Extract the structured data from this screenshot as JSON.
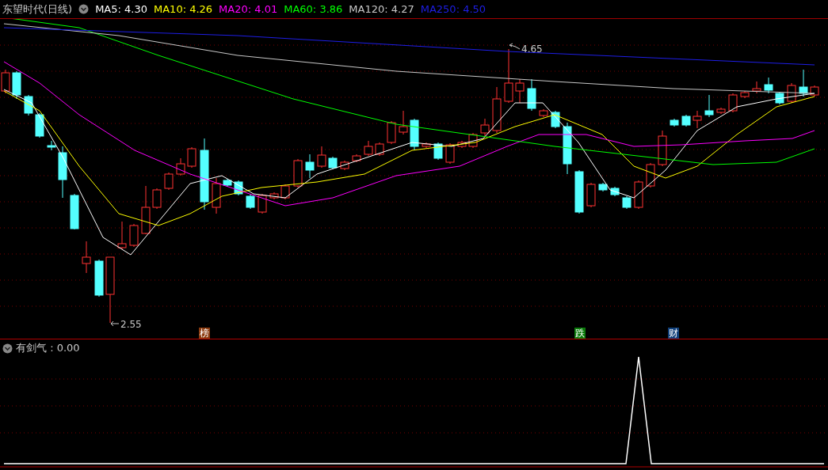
{
  "header": {
    "title": "东望时代(日线)",
    "indicators": [
      {
        "label": "MA5: 4.30",
        "color": "#ffffff"
      },
      {
        "label": "MA10: 4.26",
        "color": "#ffff00"
      },
      {
        "label": "MA20: 4.01",
        "color": "#ff00ff"
      },
      {
        "label": "MA60: 3.86",
        "color": "#00ff00"
      },
      {
        "label": "MA120: 4.27",
        "color": "#c8c8c8"
      },
      {
        "label": "MA250: 4.50",
        "color": "#1e1ee6"
      }
    ]
  },
  "main_chart": {
    "high_label": "4.65",
    "low_label": "2.55",
    "tags": [
      {
        "text": "榜",
        "color": "#8b3a0e"
      },
      {
        "text": "跌",
        "color": "#0a7a0a"
      },
      {
        "text": "财",
        "color": "#0f3f7a"
      }
    ]
  },
  "sub_chart": {
    "title": "有剑气 : 0.00"
  }
}
